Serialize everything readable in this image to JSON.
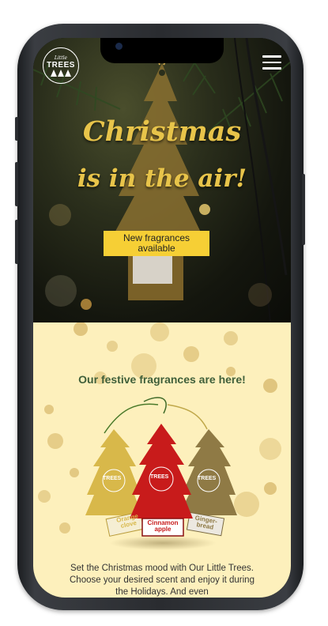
{
  "header": {
    "logo_script": "Little",
    "logo_text": "TREES",
    "menu_icon": "hamburger-menu-icon"
  },
  "hero": {
    "title_line1": "Christmas",
    "title_line2": "is in the air!",
    "cta_label": "New fragrances available"
  },
  "fragrances": {
    "heading": "Our festive fragrances are here!",
    "products": [
      {
        "name": "Orange clove",
        "label_line1": "Orange",
        "label_line2": "clove",
        "color": "#d8b84a"
      },
      {
        "name": "Cinnamon apple",
        "label_line1": "Cinnamon",
        "label_line2": "apple",
        "color": "#c81b1b"
      },
      {
        "name": "Ginger-bread",
        "label_line1": "Ginger-",
        "label_line2": "bread",
        "color": "#8f7a45"
      }
    ],
    "tree_logo_text": "TREES",
    "body_text": "Set the Christmas mood with Our Little Trees. Choose your desired scent and enjoy it during the Holidays. And even"
  },
  "colors": {
    "accent": "#f6cf35",
    "title_gold": "#e8c44a",
    "heading_green": "#3f5f3a",
    "section_bg": "#fdf0bc"
  }
}
